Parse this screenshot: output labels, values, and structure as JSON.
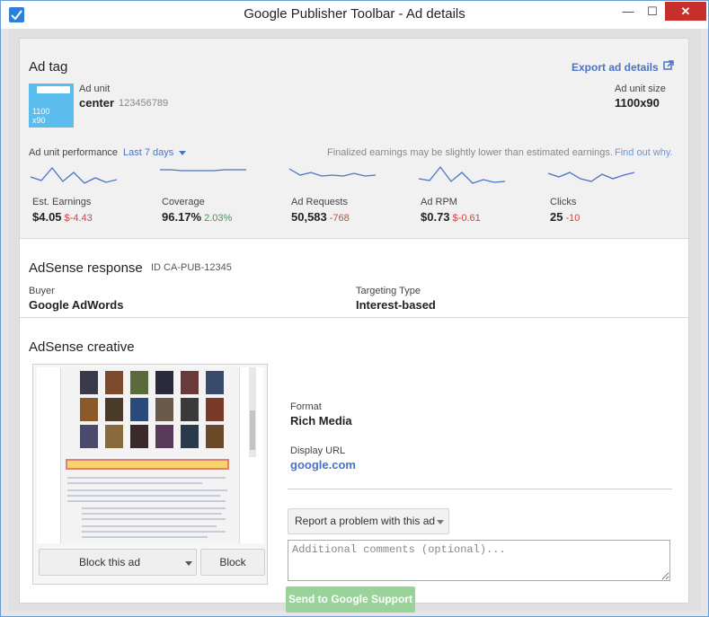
{
  "window": {
    "title": "Google Publisher Toolbar - Ad details",
    "min_glyph": "—",
    "max_glyph": "☐",
    "close_glyph": "✕"
  },
  "ad_tag": {
    "heading": "Ad tag",
    "export_label": "Export ad details",
    "thumb_line1": "1100",
    "thumb_line2": "x90",
    "ad_unit_label": "Ad unit",
    "ad_unit_name": "center",
    "ad_unit_id": "123456789",
    "size_label": "Ad unit size",
    "size_value": "1100x90"
  },
  "performance": {
    "label": "Ad unit performance",
    "range": "Last 7 days",
    "note": "Finalized earnings may be slightly lower than estimated earnings.",
    "link": "Find out why.",
    "line_color": "#4a73c4",
    "metrics": [
      {
        "name": "Est. Earnings",
        "value": "$4.05",
        "delta": "$-4.43",
        "trend": "neg",
        "spark": [
          14,
          18,
          4,
          19,
          9,
          21,
          15,
          20,
          17
        ]
      },
      {
        "name": "Coverage",
        "value": "96.17%",
        "delta": "2.03%",
        "trend": "pos",
        "spark": [
          6,
          6,
          7,
          7,
          7,
          7,
          6,
          6,
          6
        ]
      },
      {
        "name": "Ad Requests",
        "value": "50,583",
        "delta": "-768",
        "trend": "neg",
        "spark": [
          5,
          12,
          9,
          13,
          12,
          13,
          10,
          13,
          12
        ]
      },
      {
        "name": "Ad RPM",
        "value": "$0.73",
        "delta": "$-0.61",
        "trend": "neg",
        "spark": [
          16,
          18,
          3,
          19,
          9,
          21,
          17,
          20,
          19
        ]
      },
      {
        "name": "Clicks",
        "value": "25",
        "delta": "-10",
        "trend": "neg",
        "spark": [
          10,
          14,
          9,
          16,
          19,
          11,
          16,
          12,
          9
        ]
      }
    ]
  },
  "response": {
    "heading": "AdSense response",
    "id": "ID CA-PUB-12345",
    "buyer_label": "Buyer",
    "buyer_value": "Google AdWords",
    "targeting_label": "Targeting Type",
    "targeting_value": "Interest-based"
  },
  "creative": {
    "heading": "AdSense creative",
    "format_label": "Format",
    "format_value": "Rich Media",
    "display_url_label": "Display URL",
    "display_url_value": "google.com",
    "block_ad_button": "Block this ad",
    "block_button": "Block",
    "report_select": "Report a problem with this ad",
    "comments_placeholder": "Additional comments (optional)...",
    "send_button": "Send to Google Support"
  }
}
